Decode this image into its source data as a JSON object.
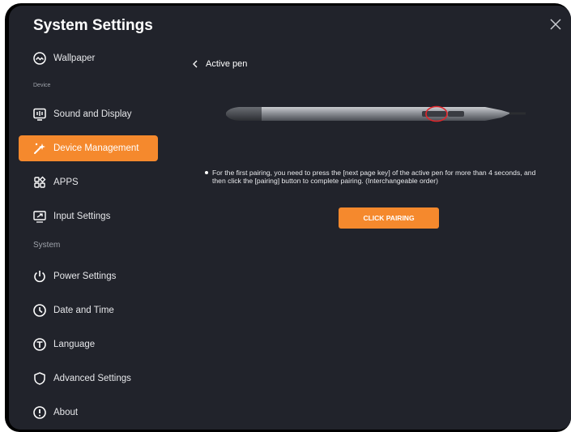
{
  "app_title": "System Settings",
  "sidebar": {
    "items": [
      {
        "label": "Wallpaper",
        "icon": "wallpaper-icon"
      },
      {
        "label": "Sound and Display",
        "icon": "sound-display-icon"
      },
      {
        "label": "Device Management",
        "icon": "device-management-icon",
        "active": true
      },
      {
        "label": "APPS",
        "icon": "apps-icon"
      },
      {
        "label": "Input Settings",
        "icon": "input-settings-icon"
      },
      {
        "label": "Power Settings",
        "icon": "power-icon"
      },
      {
        "label": "Date and Time",
        "icon": "clock-icon"
      },
      {
        "label": "Language",
        "icon": "language-icon"
      },
      {
        "label": "Advanced Settings",
        "icon": "shield-icon"
      },
      {
        "label": "About",
        "icon": "info-icon"
      }
    ],
    "section_device": "Device",
    "section_system": "System"
  },
  "page": {
    "back_label": "Active pen",
    "instruction": "For the first pairing, you need to press the [next page key] of the active pen for more than 4 seconds, and then click the [pairing] button to complete pairing. (Interchangeable order)",
    "pair_button": "CLICK PAIRING"
  },
  "colors": {
    "accent": "#f5892d",
    "background": "#21232b",
    "text": "#e6e7ea",
    "highlight_ring": "#e0262b"
  }
}
